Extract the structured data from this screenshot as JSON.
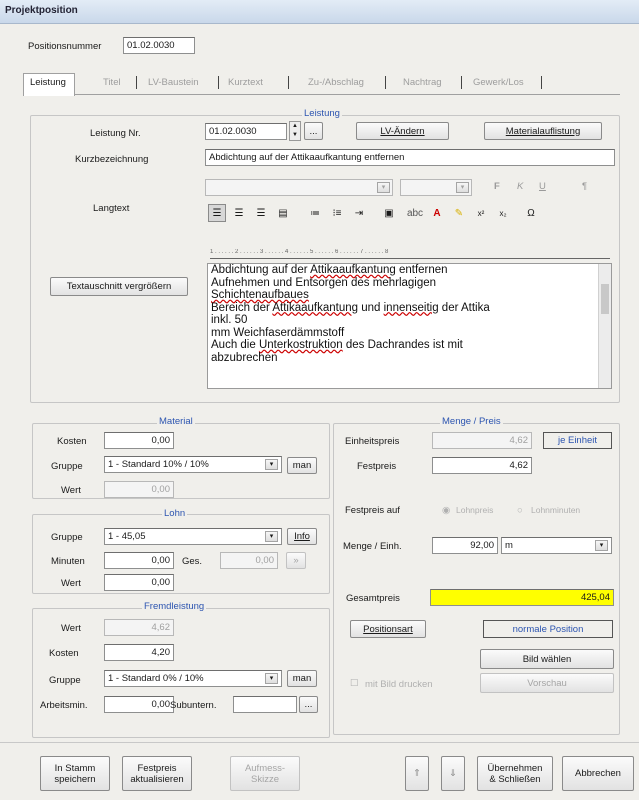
{
  "window": {
    "title": "Projektposition"
  },
  "header": {
    "positionsnummer_label": "Positionsnummer",
    "positionsnummer": "01.02.0030"
  },
  "tabs": [
    {
      "label": "Leistung"
    },
    {
      "label": "Titel"
    },
    {
      "label": "LV-Baustein"
    },
    {
      "label": "Kurztext"
    },
    {
      "label": "Zu-/Abschlag"
    },
    {
      "label": "Nachtrag"
    },
    {
      "label": "Gewerk/Los"
    }
  ],
  "leistung": {
    "group_title": "Leistung",
    "nr_label": "Leistung Nr.",
    "nr": "01.02.0030",
    "ellipsis": "...",
    "lv_aendern": "LV-Ändern",
    "materialaufl": "Materialauflistung",
    "kurz_label": "Kurzbezeichnung",
    "kurz": "Abdichtung auf der Attikaaufkantung entfernen",
    "lang_label": "Langtext",
    "textausschnitt": "Textauschnitt vergrößern",
    "fmt": {
      "f": "F",
      "k": "K",
      "u": "U",
      "para": "¶"
    },
    "ruler": "1 . . . . . . 2 . . . . . . 3 . . . . . . 4 . . . . . . 5 . . . . . . 6 . . . . . . 7 . . . . . . 8",
    "text": [
      [
        "Abdichtung auf der ",
        {
          "u": "Attikaaufkantung"
        },
        " entfernen"
      ],
      [
        "Aufnehmen und Entsorgen des mehrlagigen"
      ],
      [
        {
          "u": "Schichtenaufbaues"
        }
      ],
      [
        "Bereich der ",
        {
          "u": "Attikaaufkantung"
        },
        " und ",
        {
          "u": "innenseitig"
        },
        " der Attika"
      ],
      [
        "inkl. 50"
      ],
      [
        "mm Weichfaserdämmstoff"
      ],
      [
        "Auch die ",
        {
          "u": "Unterkostruktion"
        },
        " des Dachrandes ist mit"
      ],
      [
        "abzubrechen"
      ]
    ]
  },
  "material": {
    "title": "Material",
    "kosten_label": "Kosten",
    "kosten": "0,00",
    "gruppe_label": "Gruppe",
    "gruppe": "1 - Standard 10% / 10%",
    "man": "man",
    "wert_label": "Wert",
    "wert": "0,00"
  },
  "lohn": {
    "title": "Lohn",
    "gruppe_label": "Gruppe",
    "gruppe": "1 - 45,05",
    "info": "Info",
    "minuten_label": "Minuten",
    "minuten": "0,00",
    "ges_label": "Ges.",
    "ges": "0,00",
    "ges_btn": "»",
    "wert_label": "Wert",
    "wert": "0,00"
  },
  "fremd": {
    "title": "Fremdleistung",
    "wert_label": "Wert",
    "wert": "4,62",
    "kosten_label": "Kosten",
    "kosten": "4,20",
    "gruppe_label": "Gruppe",
    "gruppe": "1 - Standard 0% / 10%",
    "man": "man",
    "arbeitsm_label": "Arbeitsmin.",
    "arbeitsm": "0,00",
    "subunt_label": "Subuntern.",
    "ellipsis": "..."
  },
  "menge": {
    "title": "Menge / Preis",
    "einheitspreis_label": "Einheitspreis",
    "einheitspreis": "4,62",
    "je_einheit": "je Einheit",
    "festpreis_label": "Festpreis",
    "festpreis": "4,62",
    "festpreis_auf_label": "Festpreis auf",
    "radio_lohnpreis": "Lohnpreis",
    "radio_lohnminuten": "Lohnminuten",
    "menge_label": "Menge / Einh.",
    "menge": "92,00",
    "einheit": "m",
    "gesamt_label": "Gesamtpreis",
    "gesamt": "425,04",
    "positionsart": "Positionsart",
    "normale": "normale Position",
    "bild_waehlen": "Bild wählen",
    "mit_bild": "mit Bild drucken",
    "vorschau": "Vorschau"
  },
  "footer": {
    "stamm1": "In Stamm",
    "stamm2": "speichern",
    "fest1": "Festpreis",
    "fest2": "aktualisieren",
    "aufm1": "Aufmess-",
    "aufm2": "Skizze",
    "up": "⇑",
    "down": "⇓",
    "ueb1": "Übernehmen",
    "ueb2": "& Schließen",
    "abbrechen": "Abbrechen"
  },
  "colors": {
    "gesamt_bg": "#ffff00",
    "group_title": "#2d55b0"
  }
}
